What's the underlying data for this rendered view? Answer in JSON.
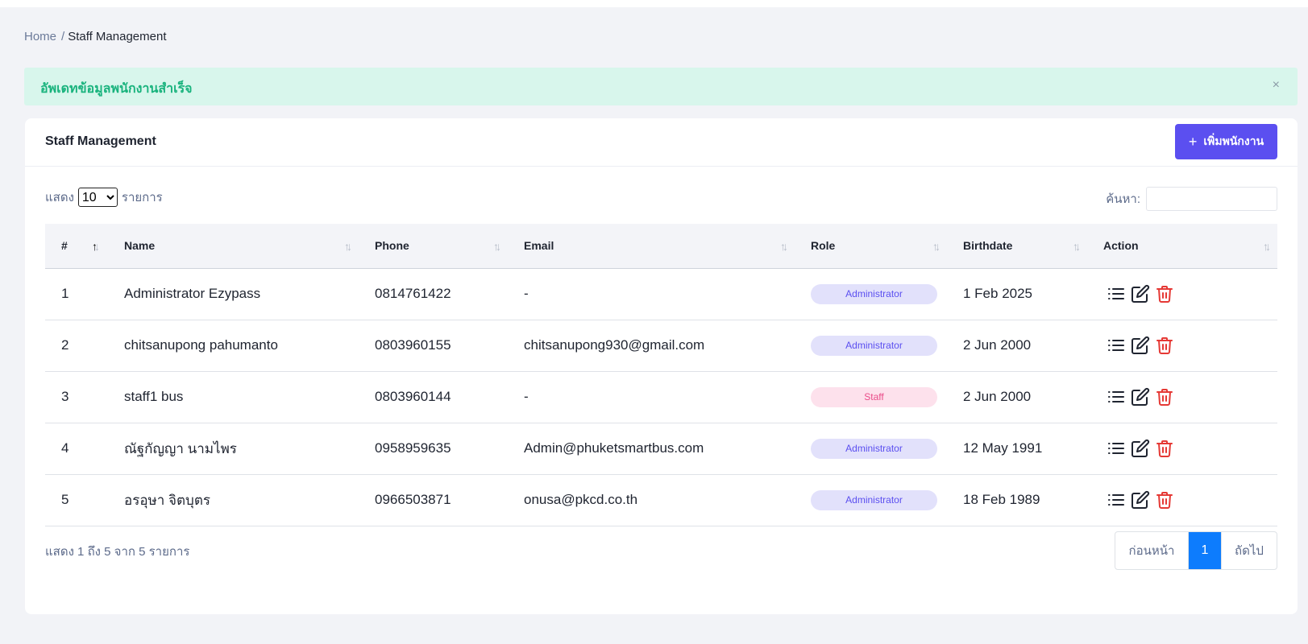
{
  "breadcrumb": {
    "home": "Home",
    "separator": "/",
    "current": "Staff Management"
  },
  "alert": {
    "message": "อัพเดทข้อมูลพนักงานสำเร็จ",
    "close": "×"
  },
  "card": {
    "title": "Staff Management",
    "add_button": "เพิ่มพนักงาน",
    "add_icon": "+"
  },
  "length": {
    "prefix": "แสดง",
    "selected": "10",
    "suffix": "รายการ"
  },
  "search": {
    "label": "ค้นหา:",
    "value": ""
  },
  "table": {
    "headers": [
      "#",
      "Name",
      "Phone",
      "Email",
      "Role",
      "Birthdate",
      "Action"
    ],
    "rows": [
      {
        "no": "1",
        "name": "Administrator Ezypass",
        "phone": "0814761422",
        "email": "-",
        "role": "Administrator",
        "birthdate": "1 Feb 2025"
      },
      {
        "no": "2",
        "name": "chitsanupong pahumanto",
        "phone": "0803960155",
        "email": "chitsanupong930@gmail.com",
        "role": "Administrator",
        "birthdate": "2 Jun 2000"
      },
      {
        "no": "3",
        "name": "staff1 bus",
        "phone": "0803960144",
        "email": "-",
        "role": "Staff",
        "birthdate": "2 Jun 2000"
      },
      {
        "no": "4",
        "name": "ณัฐกัญญา นามไพร",
        "phone": "0958959635",
        "email": "Admin@phuketsmartbus.com",
        "role": "Administrator",
        "birthdate": "12 May 1991"
      },
      {
        "no": "5",
        "name": "อรอุษา จิตบุตร",
        "phone": "0966503871",
        "email": "onusa@pkcd.co.th",
        "role": "Administrator",
        "birthdate": "18 Feb 1989"
      }
    ]
  },
  "footer": {
    "info": "แสดง 1 ถึง 5 จาก 5 รายการ",
    "prev": "ก่อนหน้า",
    "page": "1",
    "next": "ถัดไป"
  },
  "colors": {
    "accent": "#5b4ff0",
    "success_bg": "#d8f6ec",
    "success_text": "#19b37d",
    "danger": "#e53935",
    "page_active": "#0d7cfd"
  },
  "icons": {
    "view": "list-icon",
    "edit": "edit-icon",
    "delete": "trash-icon",
    "sort": "sort-icon"
  }
}
